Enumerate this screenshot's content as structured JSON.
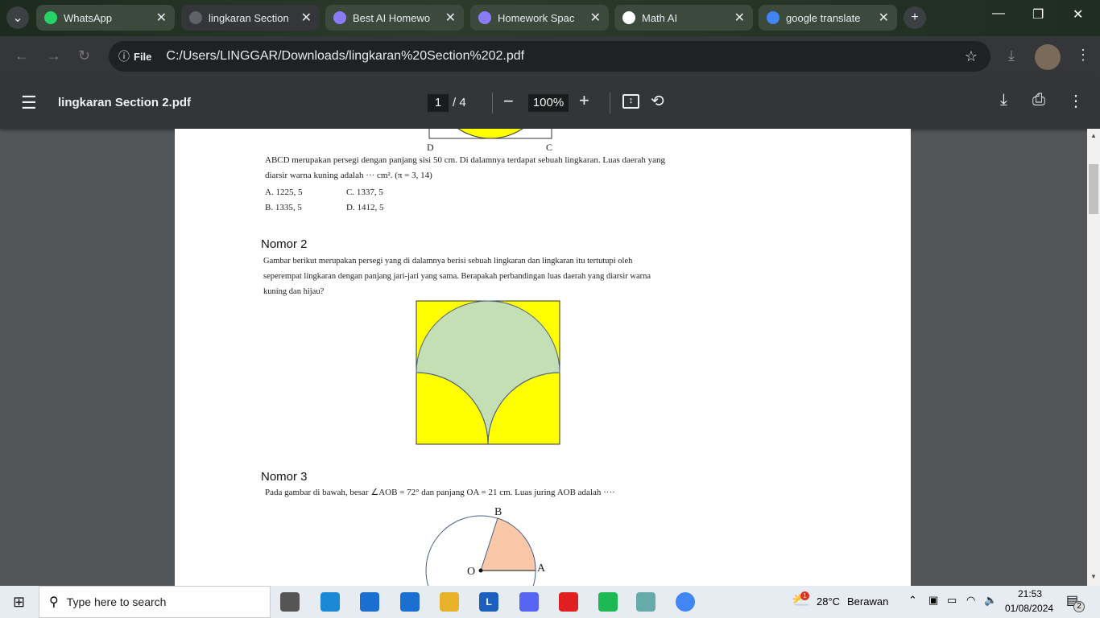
{
  "browser": {
    "tabs": [
      {
        "label": "WhatsApp",
        "icon": "whatsapp-icon",
        "color": "#25d366"
      },
      {
        "label": "lingkaran Section",
        "icon": "pdf-loading-icon",
        "color": "#5f6368"
      },
      {
        "label": "Best AI Homewo",
        "icon": "ai-gem-icon",
        "color": "#8b7cf6"
      },
      {
        "label": "Homework Spac",
        "icon": "ai-gem-icon",
        "color": "#8b7cf6"
      },
      {
        "label": "Math AI",
        "icon": "math-ai-icon",
        "color": "#ffffff"
      },
      {
        "label": "google translate",
        "icon": "google-icon",
        "color": "#4285f4"
      }
    ],
    "active_tab": 1,
    "url_scheme": "File",
    "url": "C:/Users/LINGGAR/Downloads/lingkaran%20Section%202.pdf"
  },
  "pdf": {
    "title": "lingkaran Section 2.pdf",
    "page": "1",
    "total": "/ 4",
    "zoom": "100%"
  },
  "content": {
    "q1": {
      "labels": [
        "D",
        "C"
      ],
      "text1": "ABCD merupakan persegi dengan panjang sisi 50 cm. Di dalamnya terdapat sebuah lingkaran. Luas daerah yang",
      "text2": "diarsir warna kuning adalah ··· cm². (π = 3, 14)",
      "options": [
        "A. 1225, 5",
        "C. 1337, 5",
        "B. 1335, 5",
        "D. 1412, 5"
      ]
    },
    "q2": {
      "heading": "Nomor 2",
      "lines": [
        "Gambar berikut merupakan persegi yang di dalamnya berisi sebuah lingkaran dan lingkaran itu tertutupi oleh",
        "seperempat lingkaran dengan panjang jari-jari yang sama. Berapakah perbandingan luas daerah yang diarsir warna",
        "kuning dan hijau?"
      ],
      "colors": {
        "yellow": "#ffff00",
        "green": "#c5dfb5"
      }
    },
    "q3": {
      "heading": "Nomor 3",
      "text": "Pada gambar di bawah, besar ∠AOB = 72° dan panjang OA = 21 cm. Luas juring AOB adalah ····",
      "labels": {
        "b": "B",
        "o": "O",
        "a": "A"
      },
      "sector_color": "#f8c8a8"
    }
  },
  "taskbar": {
    "search_placeholder": "Type here to search",
    "weather_temp": "28°C",
    "weather_text": "Berawan",
    "weather_badge": "1",
    "time": "21:53",
    "date": "01/08/2024",
    "notif_count": "2",
    "apps": [
      "task-view",
      "edge",
      "store",
      "mail",
      "file-explorer",
      "L",
      "discord",
      "youtube-music",
      "spotify",
      "notes",
      "chrome"
    ]
  }
}
